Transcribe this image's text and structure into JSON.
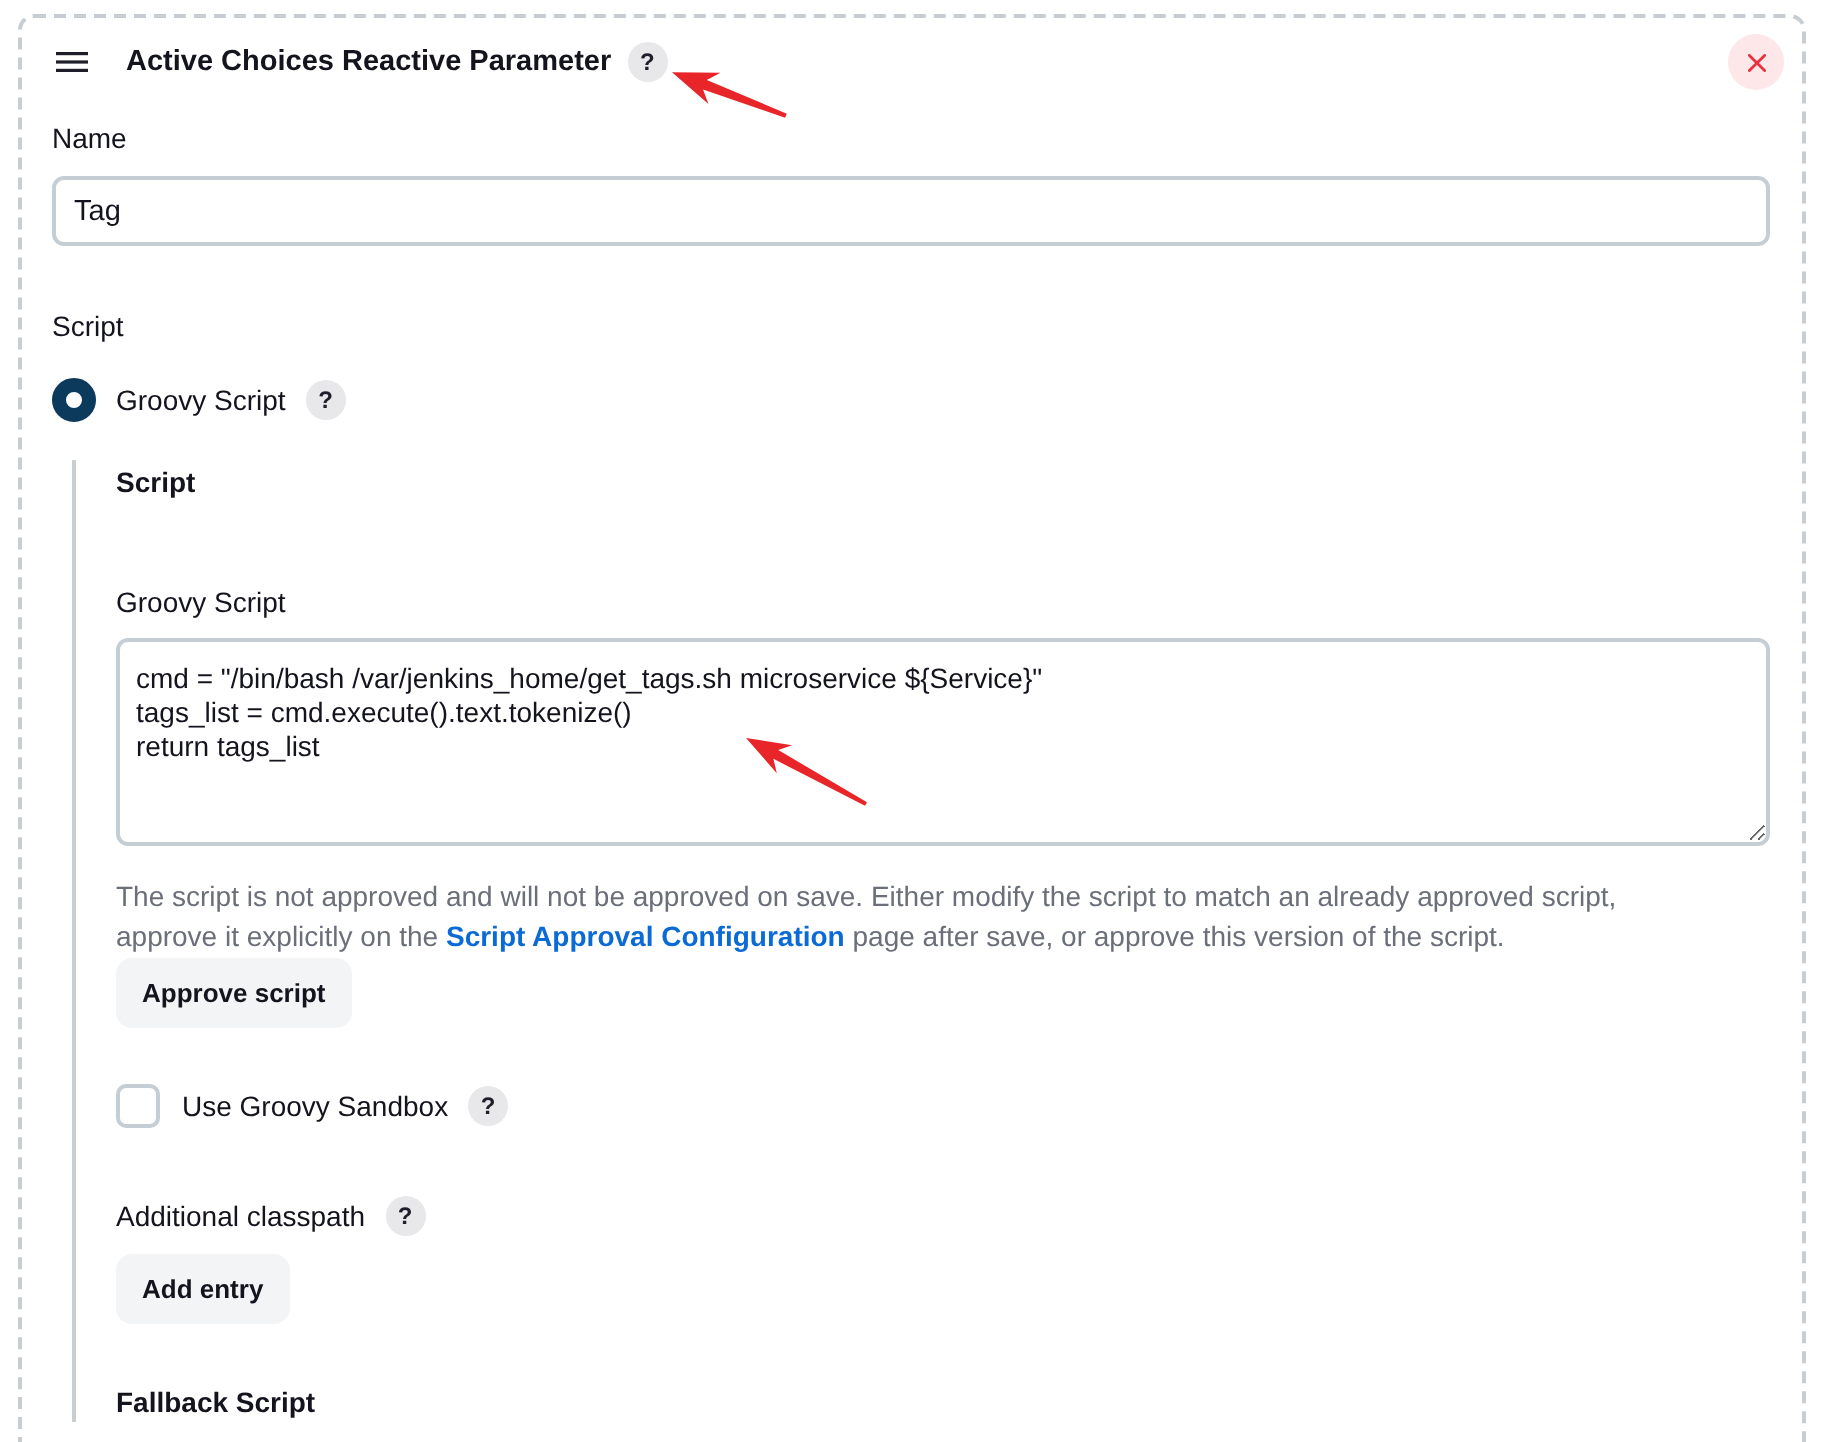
{
  "header": {
    "title": "Active Choices Reactive Parameter",
    "help": "?"
  },
  "name": {
    "label": "Name",
    "value": "Tag"
  },
  "script": {
    "label": "Script",
    "options": [
      {
        "label": "Groovy Script",
        "help": "?",
        "selected": true
      }
    ]
  },
  "groovy": {
    "section_title": "Script",
    "label": "Groovy Script",
    "value": "cmd = \"/bin/bash /var/jenkins_home/get_tags.sh microservice ${Service}\"\ntags_list = cmd.execute().text.tokenize()\nreturn tags_list",
    "notice": {
      "before": "The script is not approved and will not be approved on save. Either modify the script to match an already approved script, approve it explicitly on the",
      "link": "Script Approval Configuration",
      "after": "page after save, or approve this version of the script."
    },
    "approve_button": "Approve script",
    "sandbox": {
      "label": "Use Groovy Sandbox",
      "checked": false,
      "help": "?"
    },
    "classpath": {
      "label": "Additional classpath",
      "help": "?",
      "button": "Add entry"
    },
    "fallback_title": "Fallback Script"
  }
}
